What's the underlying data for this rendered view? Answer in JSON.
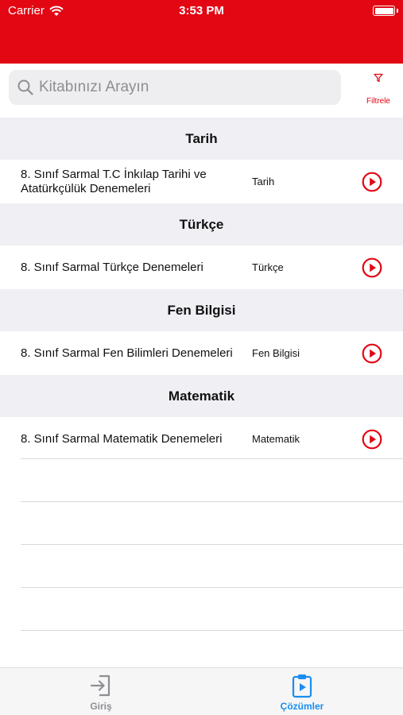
{
  "status_bar": {
    "carrier": "Carrier",
    "time": "3:53 PM",
    "battery_level": 1.0
  },
  "colors": {
    "brand_red": "#e30613",
    "tab_active": "#1a8df0",
    "tab_inactive": "#8e8e93",
    "section_bg": "#efeff4"
  },
  "search": {
    "placeholder": "Kitabınızı Arayın",
    "value": ""
  },
  "filter": {
    "label": "Filtrele",
    "icon": "filter-icon"
  },
  "sections": [
    {
      "header": "Tarih",
      "rows": [
        {
          "title": "8. Sınıf  Sarmal T.C İnkılap Tarihi ve Atatürkçülük Denemeleri",
          "subject": "Tarih"
        }
      ]
    },
    {
      "header": "Türkçe",
      "rows": [
        {
          "title": "8. Sınıf Sarmal Türkçe  Denemeleri",
          "subject": "Türkçe"
        }
      ]
    },
    {
      "header": "Fen Bilgisi",
      "rows": [
        {
          "title": "8. Sınıf Sarmal Fen Bilimleri Denemeleri",
          "subject": "Fen Bilgisi"
        }
      ]
    },
    {
      "header": "Matematik",
      "rows": [
        {
          "title": "8. Sınıf Sarmal Matematik Denemeleri",
          "subject": "Matematik"
        }
      ]
    }
  ],
  "tabbar": {
    "tabs": [
      {
        "label": "Giriş",
        "icon": "login-icon",
        "active": false
      },
      {
        "label": "Çözümler",
        "icon": "clipboard-play-icon",
        "active": true
      }
    ]
  }
}
